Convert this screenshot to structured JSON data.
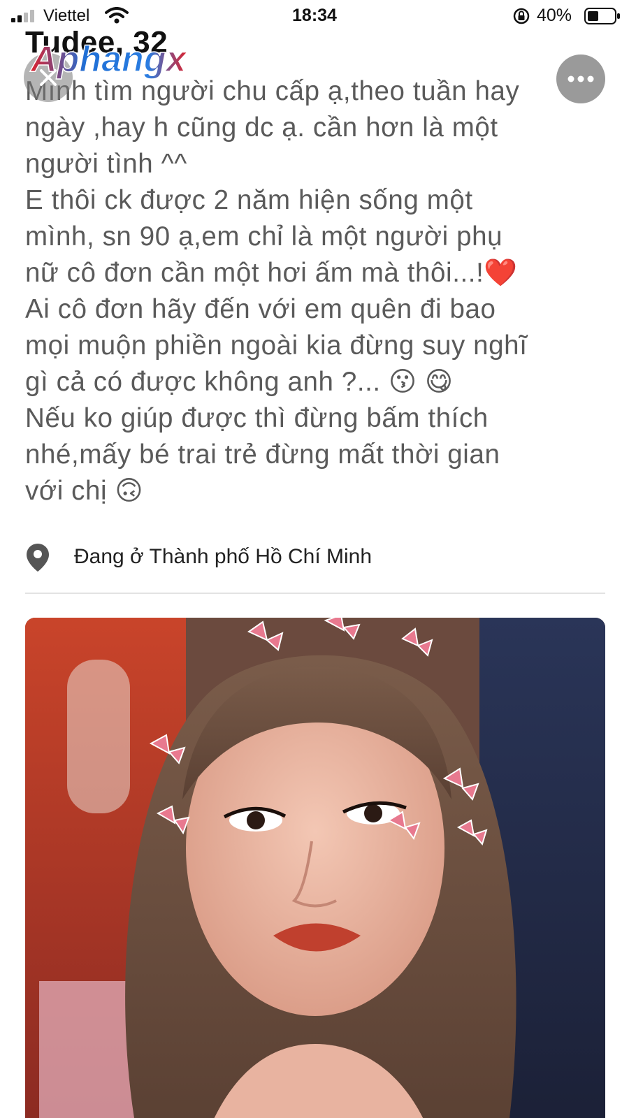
{
  "status_bar": {
    "carrier": "Viettel",
    "time": "18:34",
    "battery": "40%",
    "icons": [
      "signal-icon",
      "wifi-icon",
      "orientation-lock-icon",
      "battery-icon"
    ]
  },
  "profile": {
    "name": "Tudee, 32",
    "watermark": "Aphangx",
    "bio_lines": [
      "Mình tìm người chu cấp ạ,theo tuần hay",
      "ngày ,hay h cũng dc ạ. cần hơn là một",
      "người tình ^^",
      "E thôi ck được 2 năm hiện sống một",
      "mình, sn 90 ạ,em chỉ là một người phụ",
      "nữ cô đơn cần một hơi ấm mà thôi...!❤️",
      "Ai cô đơn hãy đến với em quên đi bao",
      "mọi muộn phiền ngoài kia đừng suy nghĩ",
      "gì cả có được không anh ?... 😗 😋",
      "Nếu ko giúp được thì đừng bấm thích",
      "nhé,mấy bé trai trẻ đừng mất thời gian",
      "với chị 🙃"
    ],
    "location": "Đang ở Thành phố Hồ Chí Minh"
  },
  "buttons": {
    "close_icon": "close-icon",
    "more_icon": "more-dots-icon"
  },
  "colors": {
    "text_gray": "#5a5a5a",
    "watermark_red": "#e0202a",
    "watermark_blue": "#2a7de1"
  }
}
